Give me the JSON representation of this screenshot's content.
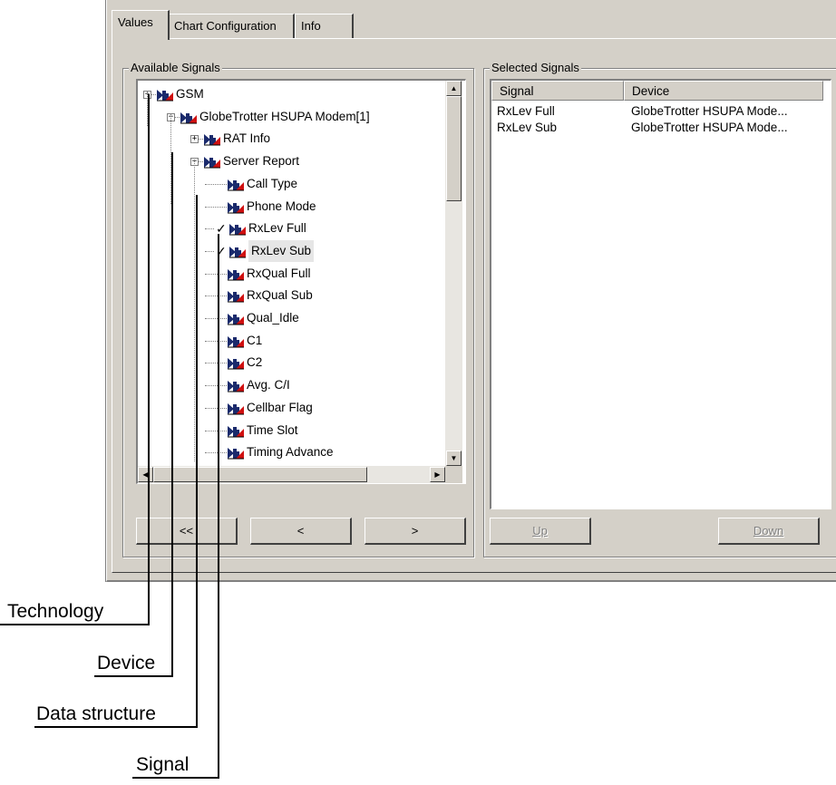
{
  "tabs": [
    "Values",
    "Chart Configuration",
    "Info"
  ],
  "available": {
    "title": "Available Signals",
    "tree": [
      {
        "label": "GSM",
        "level": 0,
        "expander": "−",
        "checked": false,
        "selected": false
      },
      {
        "label": "GlobeTrotter HSUPA Modem[1]",
        "level": 1,
        "expander": "−",
        "checked": false,
        "selected": false
      },
      {
        "label": "RAT Info",
        "level": 2,
        "expander": "+",
        "checked": false,
        "selected": false
      },
      {
        "label": "Server Report",
        "level": 2,
        "expander": "−",
        "checked": false,
        "selected": false
      },
      {
        "label": "Call Type",
        "level": 3,
        "expander": "",
        "checked": false,
        "selected": false
      },
      {
        "label": "Phone Mode",
        "level": 3,
        "expander": "",
        "checked": false,
        "selected": false
      },
      {
        "label": "RxLev Full",
        "level": 3,
        "expander": "",
        "checked": true,
        "selected": false
      },
      {
        "label": "RxLev Sub",
        "level": 3,
        "expander": "",
        "checked": true,
        "selected": true
      },
      {
        "label": "RxQual Full",
        "level": 3,
        "expander": "",
        "checked": false,
        "selected": false
      },
      {
        "label": "RxQual Sub",
        "level": 3,
        "expander": "",
        "checked": false,
        "selected": false
      },
      {
        "label": "Qual_Idle",
        "level": 3,
        "expander": "",
        "checked": false,
        "selected": false
      },
      {
        "label": "C1",
        "level": 3,
        "expander": "",
        "checked": false,
        "selected": false
      },
      {
        "label": "C2",
        "level": 3,
        "expander": "",
        "checked": false,
        "selected": false
      },
      {
        "label": "Avg. C/I",
        "level": 3,
        "expander": "",
        "checked": false,
        "selected": false
      },
      {
        "label": "Cellbar Flag",
        "level": 3,
        "expander": "",
        "checked": false,
        "selected": false
      },
      {
        "label": "Time Slot",
        "level": 3,
        "expander": "",
        "checked": false,
        "selected": false
      },
      {
        "label": "Timing Advance",
        "level": 3,
        "expander": "",
        "checked": false,
        "selected": false
      }
    ],
    "buttons": [
      "<<",
      "<",
      ">"
    ]
  },
  "selected": {
    "title": "Selected Signals",
    "columns": [
      "Signal",
      "Device"
    ],
    "rows": [
      [
        "RxLev Full",
        "GlobeTrotter HSUPA Mode..."
      ],
      [
        "RxLev Sub",
        "GlobeTrotter HSUPA Mode..."
      ]
    ],
    "up_label": "Up",
    "down_label": "Down"
  },
  "callouts": {
    "technology": "Technology",
    "device": "Device",
    "data_structure": "Data structure",
    "signal": "Signal"
  },
  "icons": {
    "signal": "signal-chart-icon",
    "check": "checkmark-icon",
    "scroll_up": "arrow-up-icon",
    "scroll_down": "arrow-down-icon",
    "scroll_left": "arrow-left-icon",
    "scroll_right": "arrow-right-icon"
  },
  "colors": {
    "dialog_bg": "#d4d0c8",
    "icon_dark": "#1a2a6c",
    "icon_red": "#d01010"
  }
}
